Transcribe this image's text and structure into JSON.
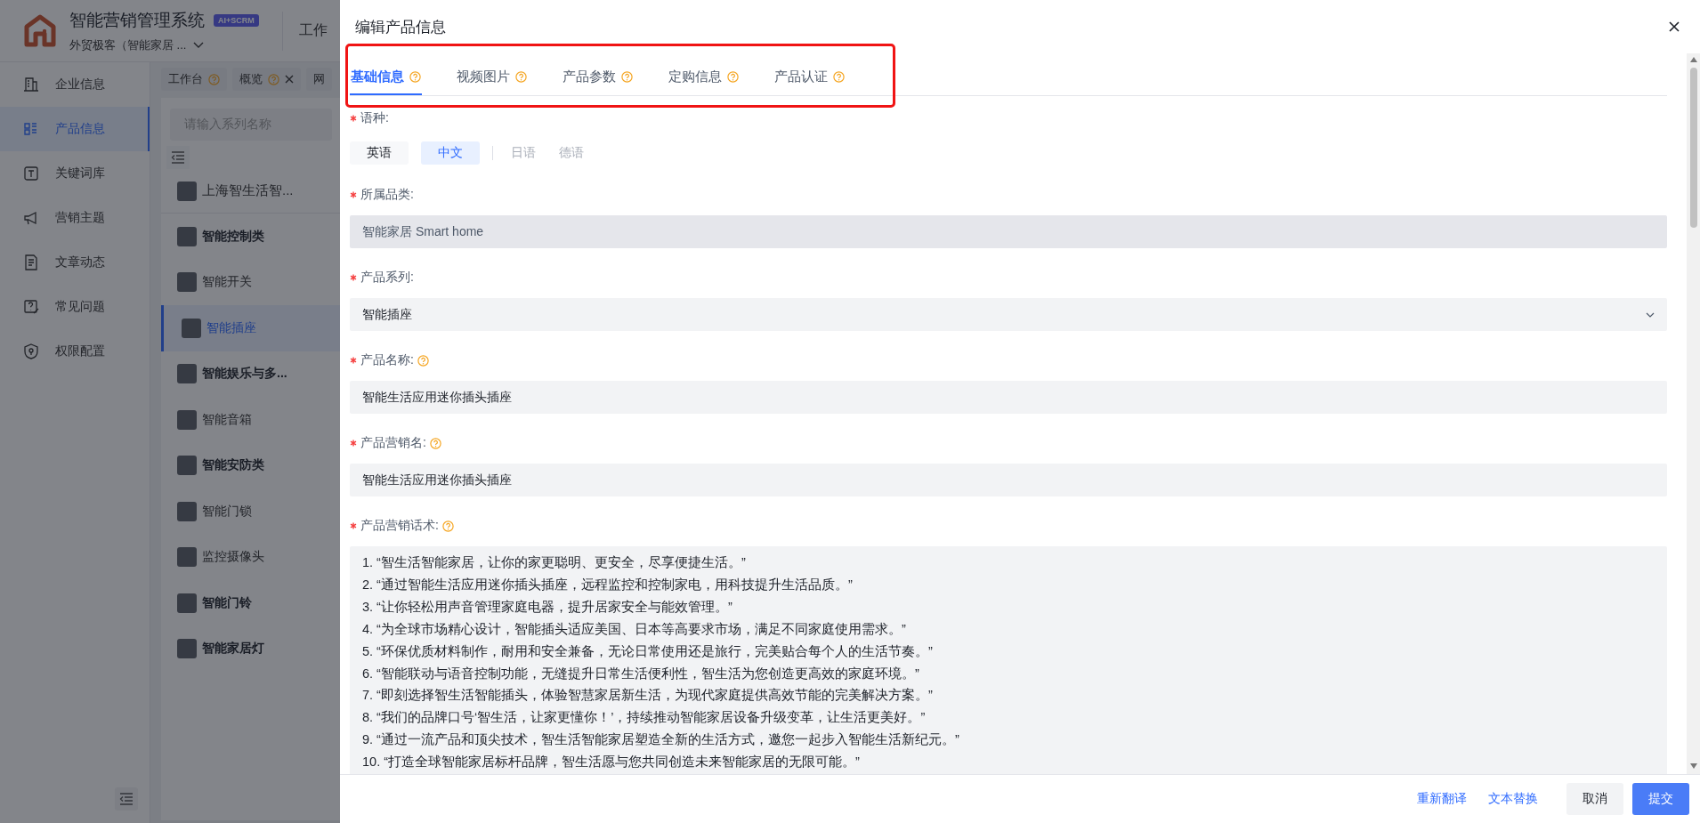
{
  "app": {
    "title": "智能营销管理系统",
    "badge": "AI+SCRM",
    "org": "外贸极客（智能家居 ...",
    "top_nav": [
      "工作"
    ]
  },
  "sidebar": {
    "items": [
      {
        "label": "企业信息",
        "selected": false
      },
      {
        "label": "产品信息",
        "selected": true
      },
      {
        "label": "关键词库",
        "selected": false
      },
      {
        "label": "营销主题",
        "selected": false
      },
      {
        "label": "文章动态",
        "selected": false
      },
      {
        "label": "常见问题",
        "selected": false
      },
      {
        "label": "权限配置",
        "selected": false
      }
    ]
  },
  "page_tabs": [
    {
      "label": "工作台",
      "help": true,
      "closable": false
    },
    {
      "label": "概览",
      "help": true,
      "closable": true
    },
    {
      "label": "网",
      "help": false,
      "closable": false
    }
  ],
  "series_panel": {
    "search": {
      "placeholder": "请输入系列名称"
    },
    "items": [
      {
        "label": "上海智生活智...",
        "kind": "company",
        "selected": false
      },
      {
        "label": "智能控制类",
        "kind": "category",
        "selected": false
      },
      {
        "label": "智能开关",
        "kind": "series",
        "selected": false
      },
      {
        "label": "智能插座",
        "kind": "series",
        "selected": true
      },
      {
        "label": "智能娱乐与多...",
        "kind": "category",
        "selected": false
      },
      {
        "label": "智能音箱",
        "kind": "series",
        "selected": false
      },
      {
        "label": "智能安防类",
        "kind": "category",
        "selected": false
      },
      {
        "label": "智能门锁",
        "kind": "series",
        "selected": false
      },
      {
        "label": "监控摄像头",
        "kind": "series",
        "selected": false
      },
      {
        "label": "智能门铃",
        "kind": "category",
        "selected": false
      },
      {
        "label": "智能家居灯",
        "kind": "category",
        "selected": false
      }
    ]
  },
  "drawer": {
    "title": "编辑产品信息",
    "tabs": [
      {
        "label": "基础信息",
        "selected": true
      },
      {
        "label": "视频图片",
        "selected": false
      },
      {
        "label": "产品参数",
        "selected": false
      },
      {
        "label": "定购信息",
        "selected": false
      },
      {
        "label": "产品认证",
        "selected": false
      }
    ],
    "fields": [
      {
        "kind": "languages",
        "label": "语种:",
        "required": true,
        "help": false,
        "options": [
          {
            "label": "英语",
            "kind": "translated",
            "selected": false
          },
          {
            "label": "中文",
            "kind": "source",
            "selected": true
          },
          {
            "label": "日语",
            "kind": "untranslated",
            "selected": false
          },
          {
            "label": "德语",
            "kind": "untranslated",
            "selected": false
          }
        ]
      },
      {
        "kind": "text",
        "label": "所属品类:",
        "required": true,
        "help": false,
        "disabled": true,
        "value": "智能家居 Smart home"
      },
      {
        "kind": "select",
        "label": "产品系列:",
        "required": true,
        "help": false,
        "disabled": false,
        "value": "智能插座"
      },
      {
        "kind": "text",
        "label": "产品名称:",
        "required": true,
        "help": true,
        "disabled": false,
        "value": "智能生活应用迷你插头插座"
      },
      {
        "kind": "text",
        "label": "产品营销名:",
        "required": true,
        "help": true,
        "disabled": false,
        "value": "智能生活应用迷你插头插座"
      },
      {
        "kind": "textarea",
        "label": "产品营销话术:",
        "required": true,
        "help": true,
        "disabled": false,
        "lines": [
          "1.  “智生活智能家居，让你的家更聪明、更安全，尽享便捷生活。”",
          "2.  “通过智能生活应用迷你插头插座，远程监控和控制家电，用科技提升生活品质。”",
          "3.  “让你轻松用声音管理家庭电器，提升居家安全与能效管理。”",
          "4.  “为全球市场精心设计，智能插头适应美国、日本等高要求市场，满足不同家庭使用需求。”",
          "5.  “环保优质材料制作，耐用和安全兼备，无论日常使用还是旅行，完美贴合每个人的生活节奏。”",
          "6.  “智能联动与语音控制功能，无缝提升日常生活便利性，智生活为您创造更高效的家庭环境。”",
          "7.  “即刻选择智生活智能插头，体验智慧家居新生活，为现代家庭提供高效节能的完美解决方案。”",
          "8.  “我们的品牌口号‘智生活，让家更懂你！’，持续推动智能家居设备升级变革，让生活更美好。”",
          "9.  “通过一流产品和顶尖技术，智生活智能家居塑造全新的生活方式，邀您一起步入智能生活新纪元。”",
          "10.  “打造全球智能家居标杆品牌，智生活愿与您共同创造未来智能家居的无限可能。”"
        ]
      }
    ],
    "actions": {
      "links": [
        "重新翻译",
        "文本替换"
      ],
      "cancel": "取消",
      "submit": "提交"
    }
  }
}
